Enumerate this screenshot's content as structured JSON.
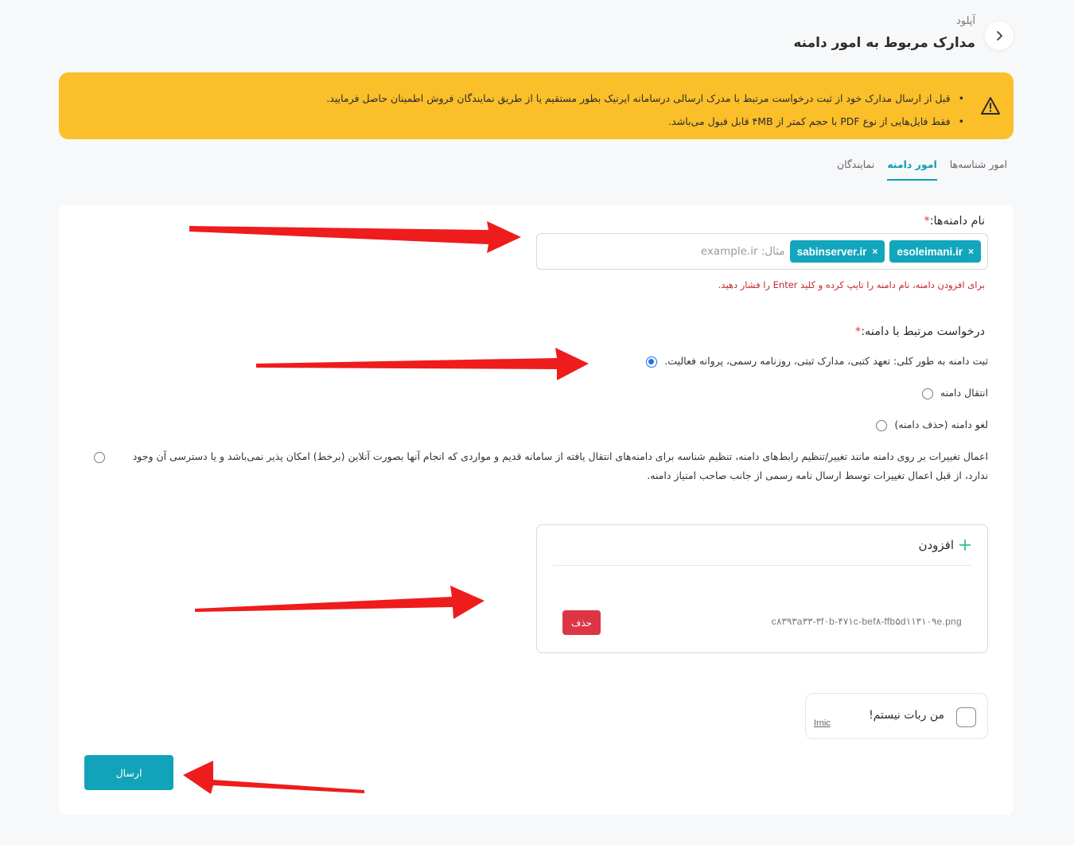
{
  "header": {
    "breadcrumb": "آپلود",
    "title": "مدارک مربوط به امور دامنه"
  },
  "banner": {
    "items": [
      "قبل از ارسال مدارک خود از ثبت درخواست مرتبط با مدرک ارسالی درسامانه ایرنیک بطور مستقیم یا از طریق نمایندگان فروش اطمینان حاصل فرمایید.",
      "فقط فایل‌هایی از نوع PDF با حجم کمتر از ۴MB قابل قبول می‌باشد."
    ],
    "color": "#fbbf2a"
  },
  "tabs": [
    {
      "label": "امور شناسه‌ها"
    },
    {
      "label": "امور دامنه"
    },
    {
      "label": "نمایندگان"
    }
  ],
  "domains": {
    "label": "نام دامنه‌ها:",
    "required_mark": "*",
    "chips": [
      "esoleimani.ir",
      "sabinserver.ir"
    ],
    "chip_remove": "×",
    "placeholder": "مثال: example.ir",
    "hint": "برای افزودن دامنه، نام دامنه را تایپ کرده و کلید Enter را فشار دهید."
  },
  "request": {
    "label": "درخواست مرتبط با دامنه:",
    "required_mark": "*",
    "options": [
      "ثبت دامنه به طور کلی: تعهد کتبی، مدارک ثبتی، روزنامه رسمی، پروانه فعالیت.",
      "انتقال دامنه",
      "لغو دامنه (حذف دامنه)",
      "اعمال تغییرات بر روی دامنه مانند تغییر/تنظیم رابط‌های دامنه، تنظیم شناسه برای دامنه‌های انتقال یافته از سامانه قدیم و مواردی که انجام آنها بصورت آنلاین (برخط) امکان پذیر نمی‌باشد و یا دسترسی آن وجود ندارد، از قبل اعمال تغییرات توسط ارسال نامه رسمی از جانب صاحب امتیاز دامنه."
    ],
    "selected_index": 0
  },
  "upload": {
    "add_label": "افزودن",
    "file_name": "c۸۳۹۳a۳۳-۳f۰b-۴۷۱c-bef۸-ffb۵d۱۱۳۱۰۹e.png",
    "delete_label": "حذف"
  },
  "captcha": {
    "label": "من ربات نیستم!",
    "brand": "Irnic"
  },
  "submit_label": "ارسال",
  "colors": {
    "accent": "#10a3b9",
    "danger": "#dc3545",
    "annotation_arrow": "#ee1c1c"
  }
}
